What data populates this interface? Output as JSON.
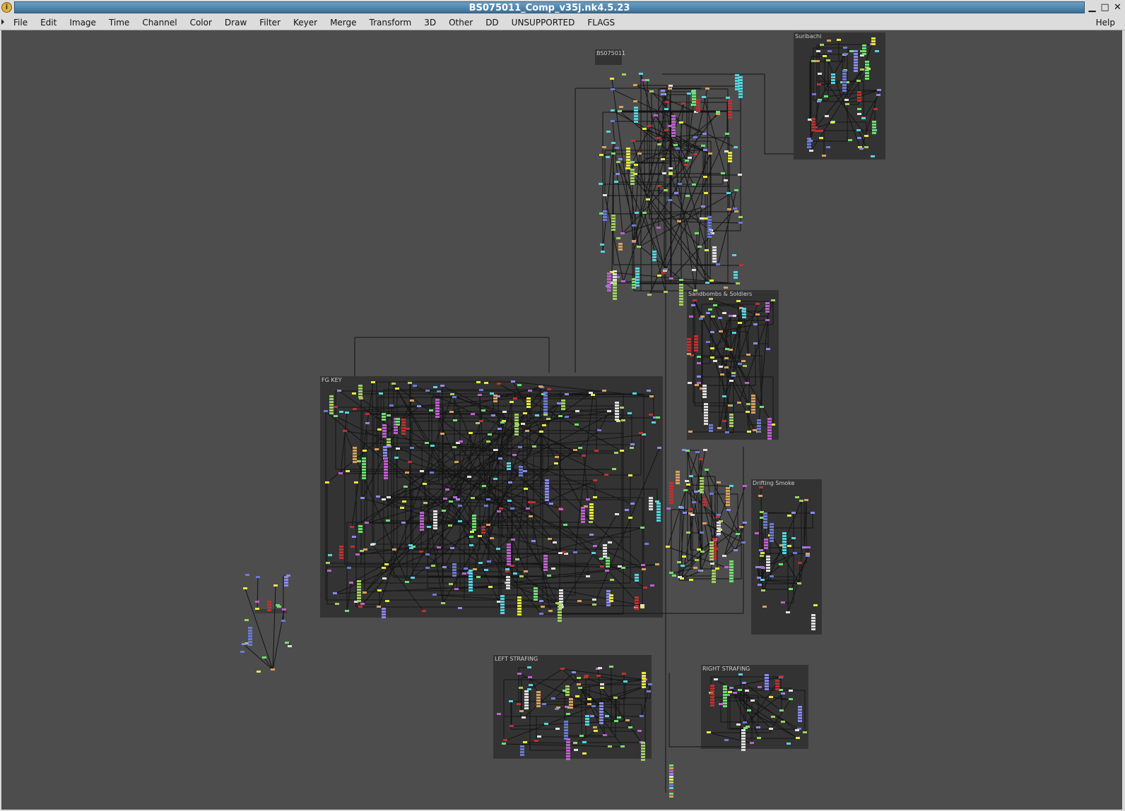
{
  "window": {
    "title": "BS075011_Comp_v35j.nk4.5.23",
    "app_icon": "info-icon",
    "controls": [
      "minimize-icon",
      "maximize-icon",
      "close-icon"
    ]
  },
  "menubar": {
    "items": [
      "File",
      "Edit",
      "Image",
      "Time",
      "Channel",
      "Color",
      "Draw",
      "Filter",
      "Keyer",
      "Merge",
      "Transform",
      "3D",
      "Other",
      "DD",
      "UNSUPPORTED",
      "FLAGS"
    ],
    "help": "Help"
  },
  "node_graph": {
    "backdrops": [
      "Suribachi",
      "Sandbombs & Soldiers",
      "FG KEY",
      "Drifting Smoke",
      "LEFT STRAFING",
      "RIGHT STRAFING"
    ],
    "top_node_label": "BS075011"
  },
  "colors": {
    "canvas": "#4d4d4d",
    "backdrop": "#333333",
    "titlebar": "#4f86ad",
    "wire": "#111111"
  }
}
